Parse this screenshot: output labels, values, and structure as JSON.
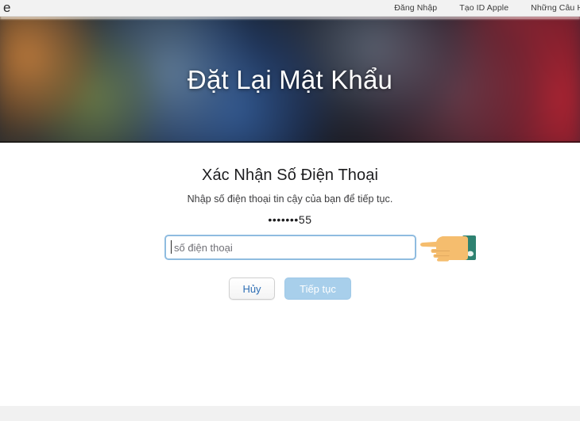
{
  "topbar": {
    "logo_text": "e",
    "nav": [
      {
        "label": "Đăng Nhập"
      },
      {
        "label": "Tạo ID Apple"
      },
      {
        "label": "Những Câu Hỏ"
      }
    ]
  },
  "hero": {
    "title": "Đặt Lại Mật Khẩu",
    "colors": {
      "left_warm": "#c47e3c",
      "mid_blue": "#3460a0",
      "right_red": "#af2432",
      "dark_base": "#1a1e28"
    }
  },
  "main": {
    "section_title": "Xác Nhận Số Điện Thoại",
    "section_subtitle": "Nhập số điện thoại tin cậy của bạn để tiếp tục.",
    "masked_number": "•••••••55",
    "phone_field": {
      "placeholder": "số điện thoại",
      "value": "",
      "focus_border_color": "#8fbce0"
    },
    "hand_pointer": {
      "icon": "pointing-hand-left-icon",
      "skin_color": "#f5bd6e",
      "sleeve_color": "#2e8271"
    },
    "buttons": {
      "cancel_label": "Hủy",
      "continue_label": "Tiếp tục",
      "cancel_text_color": "#2f6fb5",
      "continue_bg_color": "#a8cfeb"
    }
  }
}
